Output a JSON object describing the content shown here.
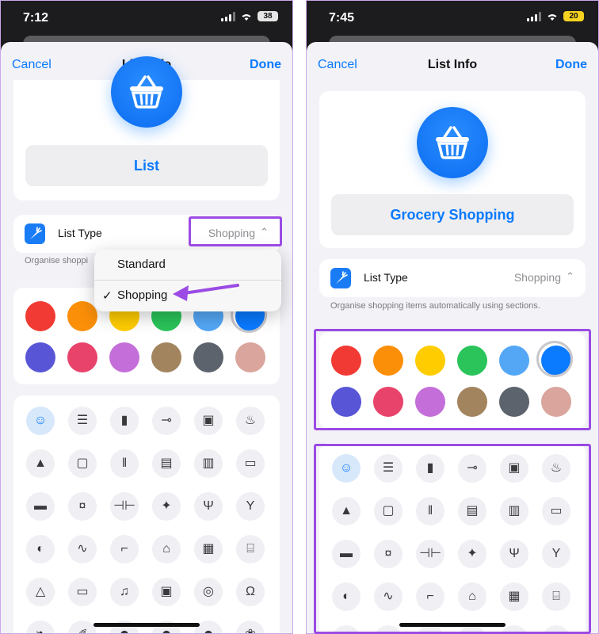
{
  "left": {
    "time": "7:12",
    "battery": "38",
    "nav": {
      "cancel": "Cancel",
      "title": "List Info",
      "done": "Done"
    },
    "list_name": "List",
    "list_type_label": "List Type",
    "list_type_value": "Shopping",
    "caption": "Organise shoppi",
    "menu": {
      "standard": "Standard",
      "shopping": "Shopping",
      "check": "✓"
    }
  },
  "right": {
    "time": "7:45",
    "battery": "20",
    "nav": {
      "cancel": "Cancel",
      "title": "List Info",
      "done": "Done"
    },
    "list_name": "Grocery Shopping",
    "list_type_label": "List Type",
    "list_type_value": "Shopping",
    "caption": "Organise shopping items automatically using sections."
  },
  "colors": [
    "#f13a33",
    "#fb8f08",
    "#ffcc00",
    "#2ac45a",
    "#54a7f5",
    "#0a7aff",
    "#5856d6",
    "#e8436a",
    "#c46fd9",
    "#a2845e",
    "#5c636c",
    "#d9a59d"
  ],
  "icons": [
    {
      "name": "smiley",
      "glyph": "☺"
    },
    {
      "name": "list",
      "glyph": "☰"
    },
    {
      "name": "bookmark",
      "glyph": "▮"
    },
    {
      "name": "pin",
      "glyph": "⊸"
    },
    {
      "name": "gift",
      "glyph": "▣"
    },
    {
      "name": "cake",
      "glyph": "♨"
    },
    {
      "name": "graduation-cap",
      "glyph": "▲"
    },
    {
      "name": "backpack",
      "glyph": "▢"
    },
    {
      "name": "ruler-pencil",
      "glyph": "‖"
    },
    {
      "name": "document",
      "glyph": "▤"
    },
    {
      "name": "book",
      "glyph": "▥"
    },
    {
      "name": "wallet",
      "glyph": "▭"
    },
    {
      "name": "credit-card",
      "glyph": "▬"
    },
    {
      "name": "money",
      "glyph": "¤"
    },
    {
      "name": "dumbbell",
      "glyph": "⊣⊢"
    },
    {
      "name": "runner",
      "glyph": "✦"
    },
    {
      "name": "fork-knife",
      "glyph": "Ψ"
    },
    {
      "name": "wine-glass",
      "glyph": "Y"
    },
    {
      "name": "pills",
      "glyph": "◐"
    },
    {
      "name": "stethoscope",
      "glyph": "∿"
    },
    {
      "name": "chair",
      "glyph": "⌐"
    },
    {
      "name": "house",
      "glyph": "⌂"
    },
    {
      "name": "building",
      "glyph": "▦"
    },
    {
      "name": "bank",
      "glyph": "⌸"
    },
    {
      "name": "tent",
      "glyph": "△"
    },
    {
      "name": "tv",
      "glyph": "▭"
    },
    {
      "name": "music-note",
      "glyph": "♫"
    },
    {
      "name": "computer",
      "glyph": "▣"
    },
    {
      "name": "gamepad",
      "glyph": "◎"
    },
    {
      "name": "headphones",
      "glyph": "Ω"
    },
    {
      "name": "leaf",
      "glyph": "❧"
    },
    {
      "name": "carrot",
      "glyph": "✐"
    },
    {
      "name": "people",
      "glyph": "☻"
    },
    {
      "name": "people",
      "glyph": "☻"
    },
    {
      "name": "family",
      "glyph": "☻"
    },
    {
      "name": "paw",
      "glyph": "❀"
    }
  ]
}
